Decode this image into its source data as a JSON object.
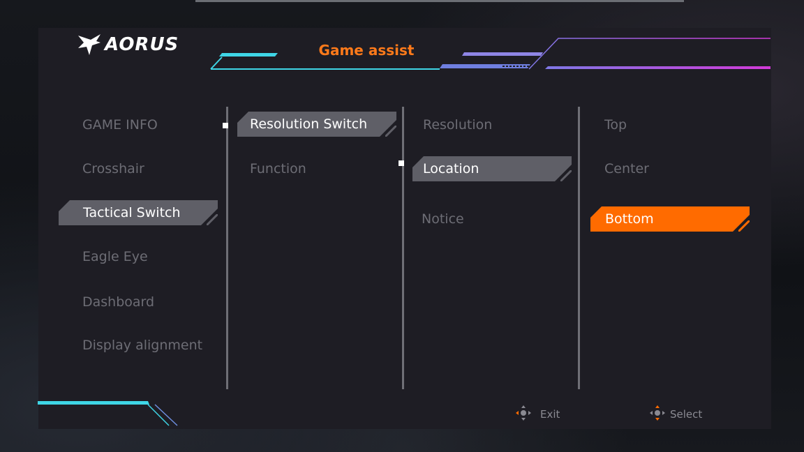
{
  "header": {
    "logo_text": "AORUS",
    "title": "Game assist"
  },
  "menu": {
    "column1": [
      {
        "label": "GAME INFO",
        "state": "normal"
      },
      {
        "label": "Crosshair",
        "state": "normal"
      },
      {
        "label": "Tactical Switch",
        "state": "active"
      },
      {
        "label": "Eagle Eye",
        "state": "normal"
      },
      {
        "label": "Dashboard",
        "state": "normal"
      },
      {
        "label": "Display alignment",
        "state": "normal"
      }
    ],
    "column2": [
      {
        "label": "Resolution Switch",
        "state": "active"
      },
      {
        "label": "Function",
        "state": "normal"
      }
    ],
    "column3": [
      {
        "label": "Resolution",
        "state": "normal"
      },
      {
        "label": "Location",
        "state": "active"
      },
      {
        "label": "Notice",
        "state": "normal"
      }
    ],
    "column4": [
      {
        "label": "Top",
        "state": "normal"
      },
      {
        "label": "Center",
        "state": "normal"
      },
      {
        "label": "Bottom",
        "state": "selected"
      }
    ]
  },
  "footer": {
    "exit_label": "Exit",
    "select_label": "Select"
  },
  "colors": {
    "accent_orange": "#ff6b00",
    "title_orange": "#ff7a1a",
    "active_gray": "#5f5f67",
    "inactive_text": "#6d6d75",
    "cyan_line": "#3fd6e6",
    "magenta_line": "#d23ad8",
    "panel_bg": "#1e1d24"
  },
  "icons": {
    "logo": "aorus-eagle-icon",
    "exit": "joystick-exit-icon",
    "select": "joystick-select-icon"
  }
}
